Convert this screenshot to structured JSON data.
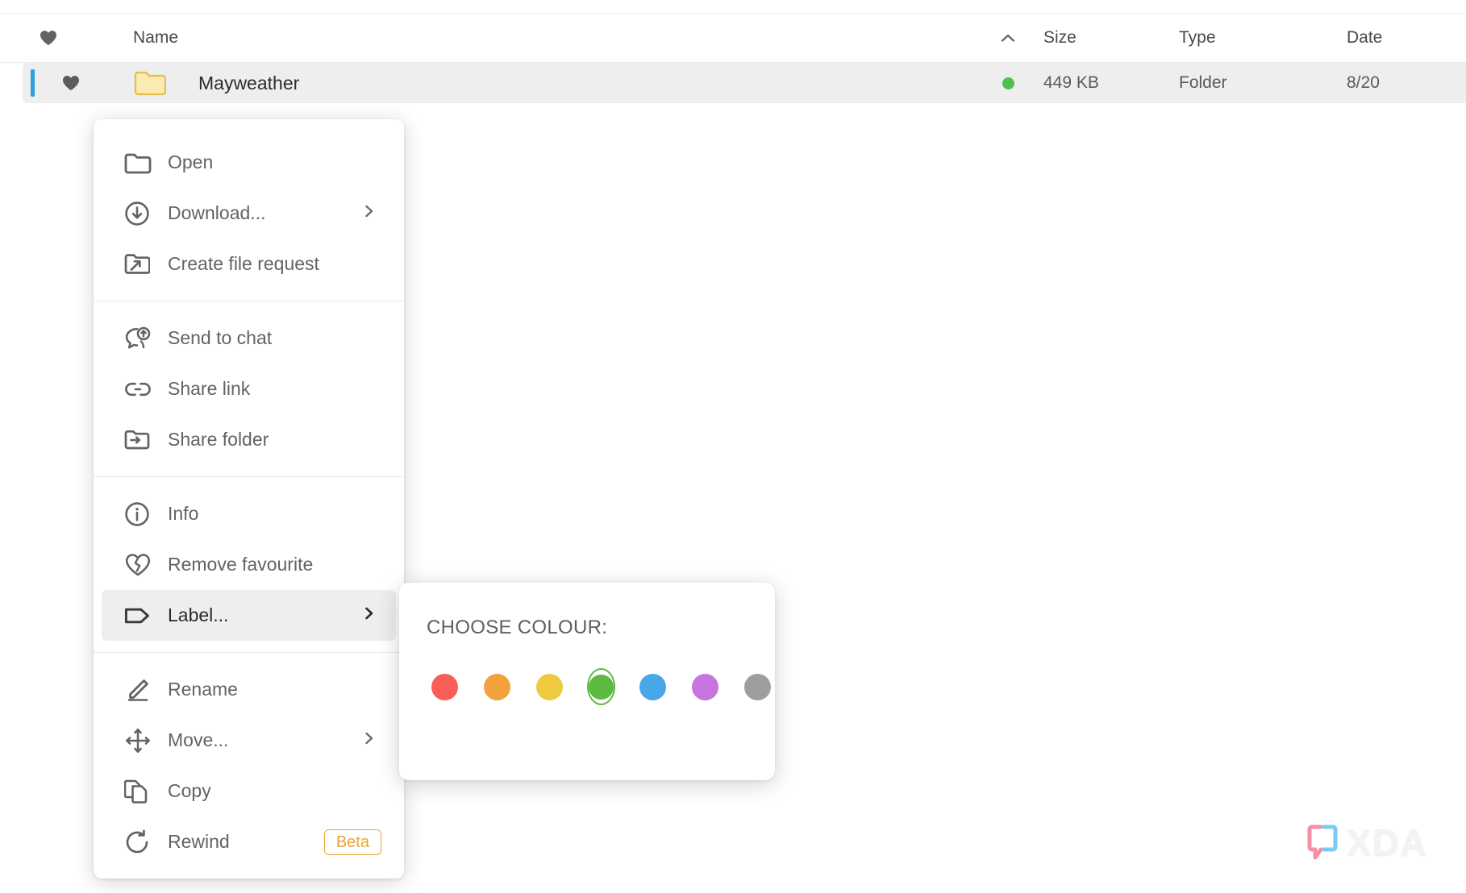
{
  "file_list": {
    "columns": {
      "favourite_icon": "heart-icon",
      "name": "Name",
      "sort_icon": "chevron-up-icon",
      "size": "Size",
      "type": "Type",
      "date": "Date"
    },
    "rows": [
      {
        "favourite_icon": "heart-filled-icon",
        "type_icon": "folder-icon",
        "name": "Mayweather",
        "status_dot_color": "#4CC24C",
        "size": "449 KB",
        "type": "Folder",
        "date": "8/20",
        "selected": true
      }
    ]
  },
  "context_menu": {
    "groups": [
      {
        "items": [
          {
            "icon": "folder-open-icon",
            "label": "Open",
            "submenu": false,
            "badge": null,
            "active": false
          },
          {
            "icon": "download-circle-icon",
            "label": "Download...",
            "submenu": true,
            "badge": null,
            "active": false
          },
          {
            "icon": "file-request-icon",
            "label": "Create file request",
            "submenu": false,
            "badge": null,
            "active": false
          }
        ]
      },
      {
        "items": [
          {
            "icon": "send-to-chat-icon",
            "label": "Send to chat",
            "submenu": false,
            "badge": null,
            "active": false
          },
          {
            "icon": "link-icon",
            "label": "Share link",
            "submenu": false,
            "badge": null,
            "active": false
          },
          {
            "icon": "share-folder-icon",
            "label": "Share folder",
            "submenu": false,
            "badge": null,
            "active": false
          }
        ]
      },
      {
        "items": [
          {
            "icon": "info-icon",
            "label": "Info",
            "submenu": false,
            "badge": null,
            "active": false
          },
          {
            "icon": "broken-heart-icon",
            "label": "Remove favourite",
            "submenu": false,
            "badge": null,
            "active": false
          },
          {
            "icon": "tag-icon",
            "label": "Label...",
            "submenu": true,
            "badge": null,
            "active": true
          }
        ]
      },
      {
        "items": [
          {
            "icon": "pencil-icon",
            "label": "Rename",
            "submenu": false,
            "badge": null,
            "active": false
          },
          {
            "icon": "move-arrows-icon",
            "label": "Move...",
            "submenu": true,
            "badge": null,
            "active": false
          },
          {
            "icon": "copy-icon",
            "label": "Copy",
            "submenu": false,
            "badge": null,
            "active": false
          },
          {
            "icon": "rewind-icon",
            "label": "Rewind",
            "submenu": false,
            "badge": "Beta",
            "active": false
          }
        ]
      }
    ]
  },
  "colour_popover": {
    "title": "CHOOSE COLOUR:",
    "selected_index": 3,
    "swatches": [
      {
        "name": "red",
        "color": "#F95D57"
      },
      {
        "name": "orange",
        "color": "#F2A23C"
      },
      {
        "name": "yellow",
        "color": "#EFCA3E"
      },
      {
        "name": "green",
        "color": "#5CBA41"
      },
      {
        "name": "blue",
        "color": "#48A7E8"
      },
      {
        "name": "purple",
        "color": "#C874DE"
      },
      {
        "name": "grey",
        "color": "#9E9E9E"
      }
    ]
  },
  "watermark": {
    "text": "XDA",
    "bracket_left_color": "#F4879E",
    "bracket_right_color": "#6FC7F0"
  }
}
